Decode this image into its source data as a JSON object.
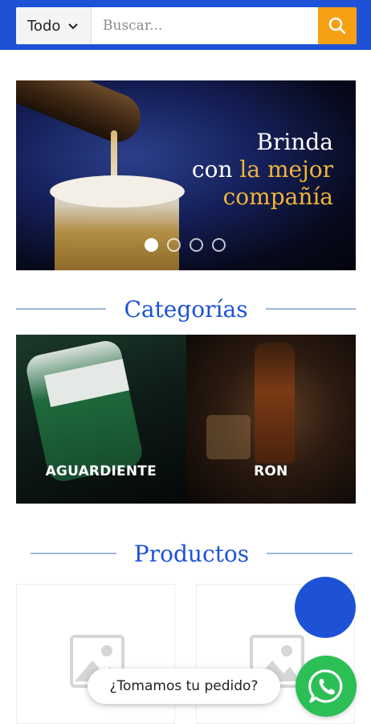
{
  "search": {
    "category_selected": "Todo",
    "placeholder": "Buscar..."
  },
  "hero": {
    "line1": "Brinda",
    "line2_white": "con ",
    "line2_gold": "la mejor",
    "line3_gold": "compañía",
    "slides": 4,
    "active_slide": 1
  },
  "categories": {
    "title": "Categorías",
    "items": [
      {
        "label": "AGUARDIENTE"
      },
      {
        "label": "RON"
      }
    ]
  },
  "products": {
    "title": "Productos",
    "items": [
      {
        "image": "image-placeholder-icon"
      },
      {
        "image": "image-placeholder-icon"
      }
    ]
  },
  "chat": {
    "bubble_text": "¿Tomamos tu pedido?",
    "icon": "whatsapp-icon"
  },
  "colors": {
    "brand_blue": "#1d52d6",
    "accent_orange": "#f5a014",
    "gold_text": "#f0b43a",
    "whatsapp_green": "#2cbf56"
  }
}
